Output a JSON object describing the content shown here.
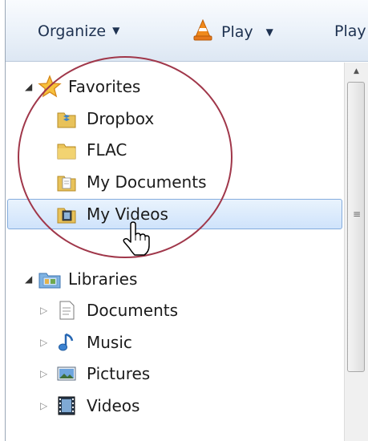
{
  "toolbar": {
    "organize_label": "Organize",
    "play_label": "Play",
    "play_cut_label": "Play"
  },
  "tree": {
    "favorites": {
      "label": "Favorites",
      "items": [
        {
          "label": "Dropbox",
          "icon": "dropbox-folder-icon"
        },
        {
          "label": "FLAC",
          "icon": "folder-icon"
        },
        {
          "label": "My Documents",
          "icon": "documents-folder-icon"
        },
        {
          "label": "My Videos",
          "icon": "videos-folder-icon",
          "selected": true
        }
      ]
    },
    "libraries": {
      "label": "Libraries",
      "items": [
        {
          "label": "Documents",
          "icon": "document-icon"
        },
        {
          "label": "Music",
          "icon": "music-note-icon"
        },
        {
          "label": "Pictures",
          "icon": "pictures-icon"
        },
        {
          "label": "Videos",
          "icon": "film-icon"
        }
      ]
    }
  },
  "colors": {
    "selection_border": "#84acdd",
    "selection_fill": "#d9e9fc",
    "annotation_circle": "#a0374a",
    "toolbar_text": "#1e3251"
  }
}
